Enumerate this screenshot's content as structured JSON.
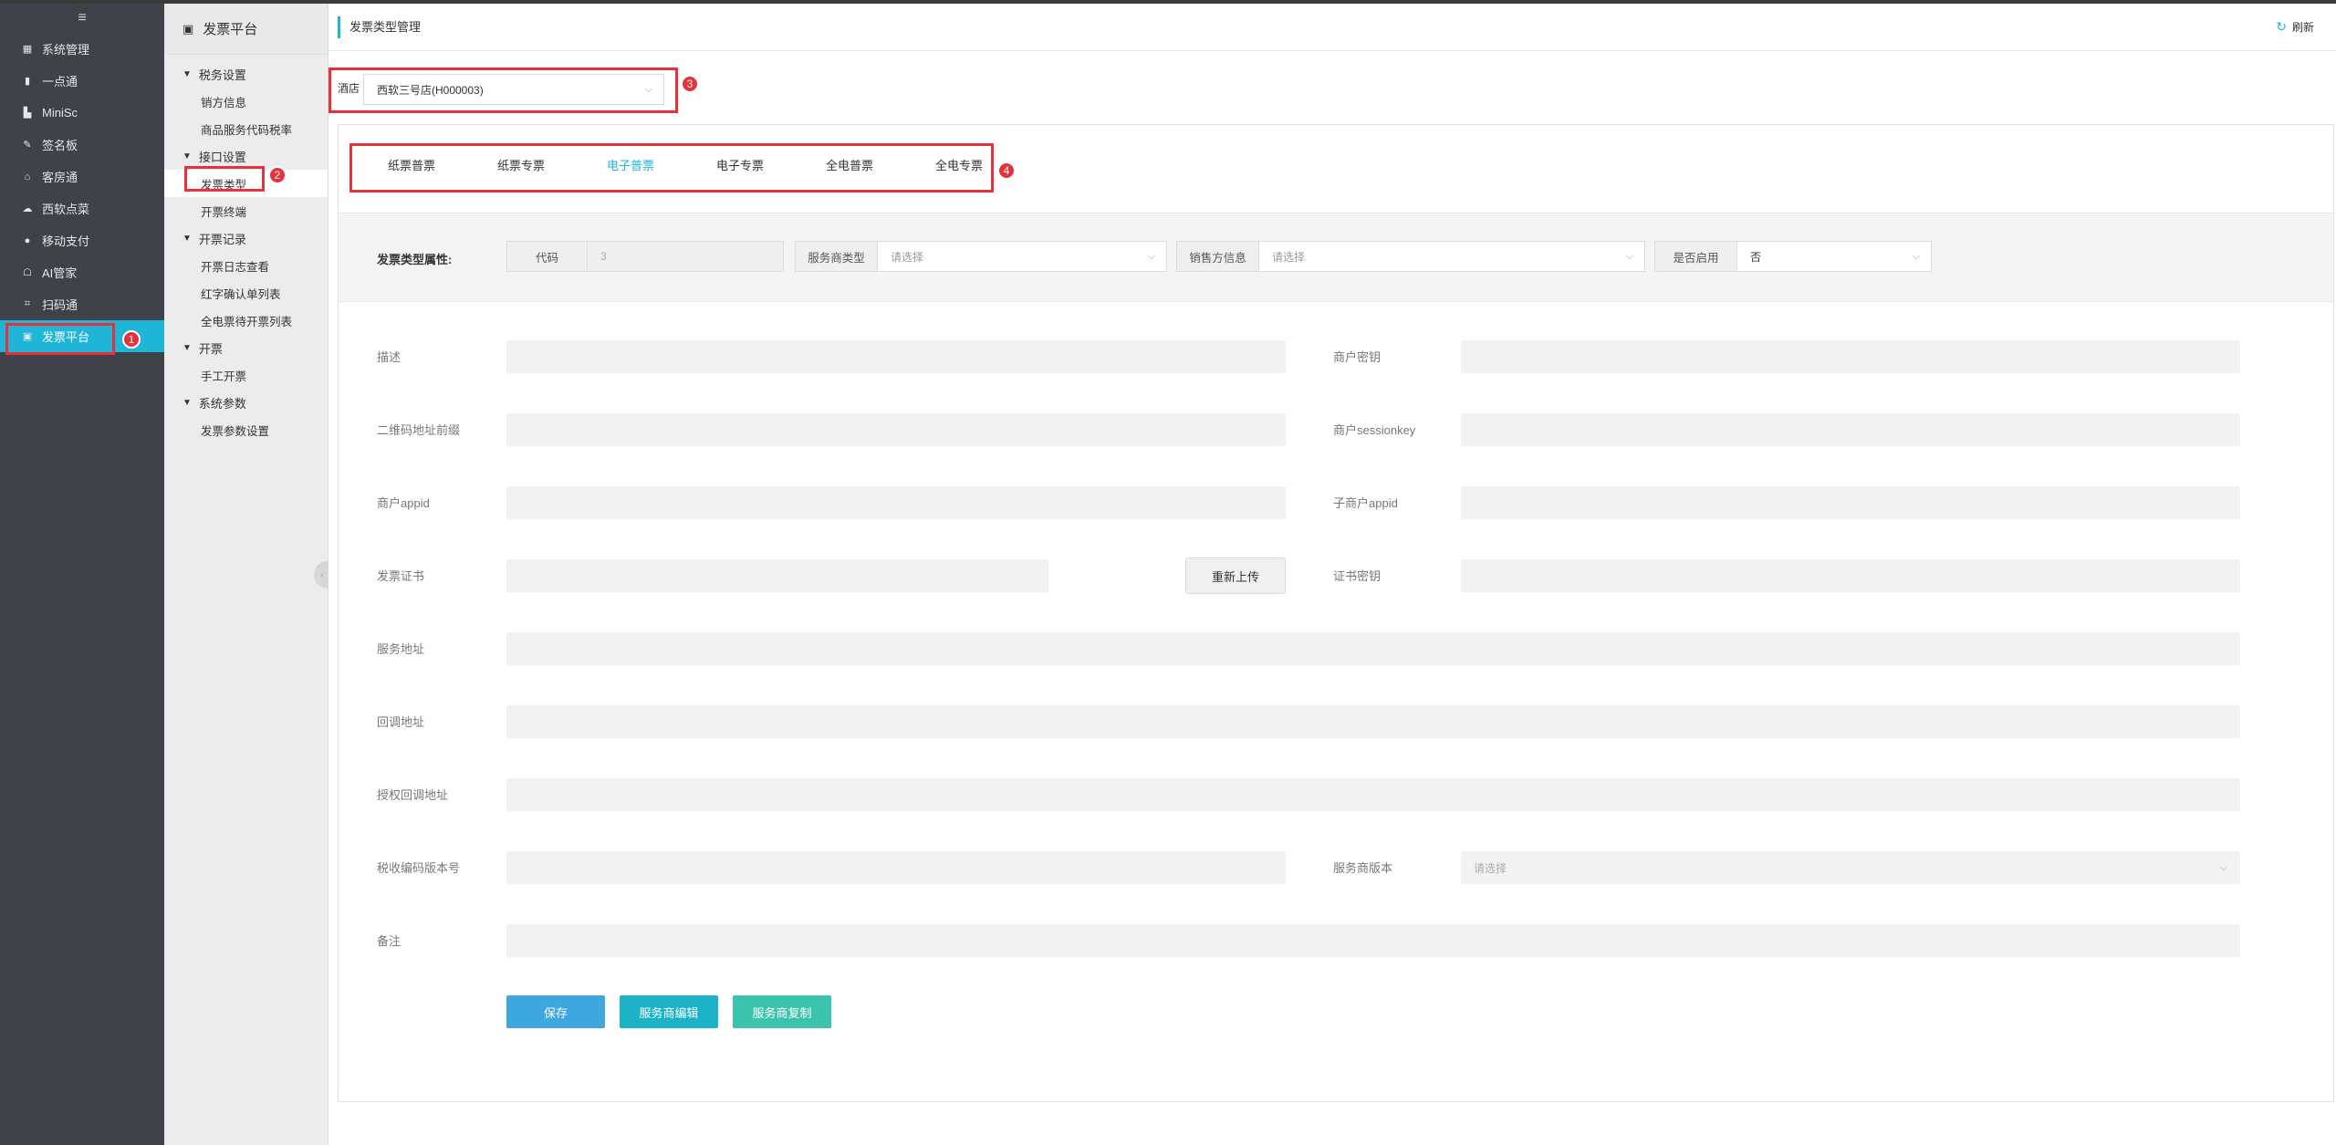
{
  "sidebar": {
    "menu_icon": "≡",
    "items": [
      {
        "label": "系统管理",
        "icon": "grid-icon"
      },
      {
        "label": "一点通",
        "icon": "bar-chart-icon"
      },
      {
        "label": "MiniSc",
        "icon": "mini-chart-icon"
      },
      {
        "label": "签名板",
        "icon": "pen-icon"
      },
      {
        "label": "客房通",
        "icon": "home-icon"
      },
      {
        "label": "西软点菜",
        "icon": "cloud-icon"
      },
      {
        "label": "移动支付",
        "icon": "pay-icon"
      },
      {
        "label": "AI管家",
        "icon": "robot-icon"
      },
      {
        "label": "扫码通",
        "icon": "scan-icon"
      },
      {
        "label": "发票平台",
        "icon": "invoice-icon"
      }
    ],
    "active": "发票平台",
    "accent": "#1fb5d6"
  },
  "subnav": {
    "title": "发票平台",
    "groups": [
      {
        "label": "税务设置",
        "items": [
          "销方信息",
          "商品服务代码税率"
        ]
      },
      {
        "label": "接口设置",
        "items": [
          "发票类型",
          "开票终端"
        ]
      },
      {
        "label": "开票记录",
        "items": [
          "开票日志查看",
          "红字确认单列表",
          "全电票待开票列表"
        ]
      },
      {
        "label": "开票",
        "items": [
          "手工开票"
        ]
      },
      {
        "label": "系统参数",
        "items": [
          "发票参数设置"
        ]
      }
    ],
    "current": "发票类型"
  },
  "header": {
    "title": "发票类型管理",
    "refresh_label": "刷新"
  },
  "hotel": {
    "label": "酒店",
    "value": "西软三号店(H000003)"
  },
  "tabs": [
    "纸票普票",
    "纸票专票",
    "电子普票",
    "电子专票",
    "全电普票",
    "全电专票"
  ],
  "active_tab": "电子普票",
  "attr": {
    "title": "发票类型属性:",
    "code_label": "代码",
    "code_value": "3",
    "provider_label": "服务商类型",
    "provider_placeholder": "请选择",
    "seller_label": "销售方信息",
    "seller_placeholder": "请选择",
    "enabled_label": "是否启用",
    "enabled_value": "否"
  },
  "form": {
    "desc": "描述",
    "merchant_key": "商户密钥",
    "qr_prefix": "二维码地址前缀",
    "merchant_session": "商户sessionkey",
    "merchant_appid": "商户appid",
    "sub_merchant_appid": "子商户appid",
    "cert": "发票证书",
    "reupload": "重新上传",
    "cert_key": "证书密钥",
    "service_url": "服务地址",
    "callback_url": "回调地址",
    "auth_callback_url": "授权回调地址",
    "tax_code_version": "税收编码版本号",
    "provider_version": "服务商版本",
    "provider_version_placeholder": "请选择",
    "remark": "备注"
  },
  "buttons": {
    "save": "保存",
    "provider_edit": "服务商编辑",
    "provider_copy": "服务商复制"
  },
  "badges": [
    "1",
    "2",
    "3",
    "4"
  ],
  "colors": {
    "save": "#3fa7e0",
    "edit": "#1cb3c8",
    "copy": "#3cc3ad",
    "annotation": "#e5323a"
  }
}
